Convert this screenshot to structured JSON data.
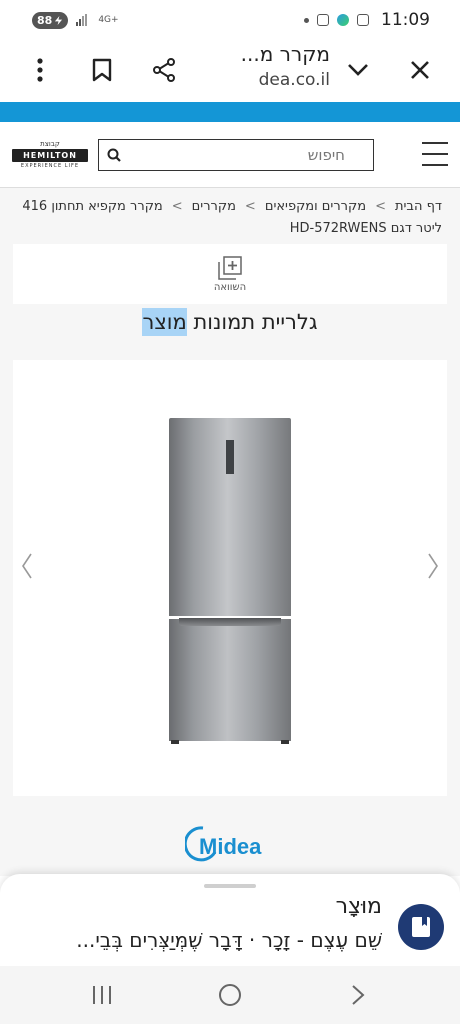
{
  "status_bar": {
    "battery": "88",
    "network": "4G+",
    "time": "11:09",
    "icons": [
      "notification-dot-icon",
      "voicemail-icon",
      "edge-browser-icon",
      "instagram-icon"
    ]
  },
  "toolbar": {
    "page_title": "מקרר מ...",
    "host": "dea.co.il",
    "icons": [
      "menu-dots-icon",
      "bookmark-icon",
      "share-icon",
      "chevron-down-icon",
      "close-icon"
    ]
  },
  "header": {
    "brand_small": "קבוצת",
    "brand_main": "HEMILTON",
    "brand_sub": "EXPERIENCE LIFE",
    "search_placeholder": "חיפוש"
  },
  "breadcrumb": {
    "items": [
      "דף הבית",
      "מקררים ומקפיאים",
      "מקררים",
      "מקרר מקפיא תחתון 416"
    ],
    "separator": ">",
    "line2": "ליטר דגם HD-572RWENS"
  },
  "compare": {
    "label": "השוואה"
  },
  "gallery": {
    "title_plain": "גלריית תמונות ",
    "title_highlight": "מוצר"
  },
  "brand_logo": "Midea",
  "dictionary": {
    "word": "מוּצָר",
    "definition": "שֵׁם עֶצֶם - זָכָר · דָּבָר שֶׁמְּיַצְּרִים בְּבֵי..."
  },
  "colors": {
    "site_blue": "#1496d6",
    "midea_blue": "#1a8fd0",
    "highlight": "#a8d4f6",
    "sheet_icon_bg": "#1f3a74"
  }
}
